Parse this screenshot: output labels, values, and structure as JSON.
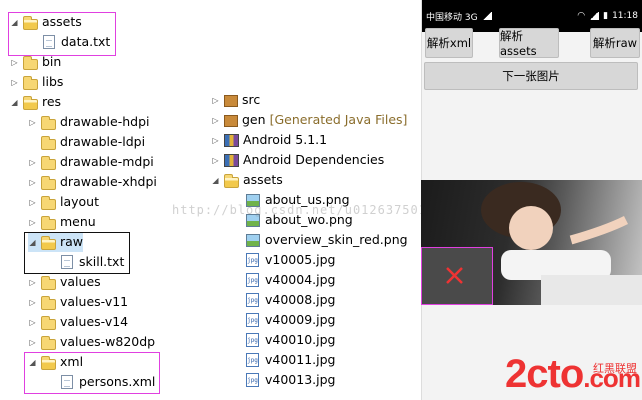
{
  "left_tree": [
    {
      "label": "assets",
      "level": 0,
      "type": "folder",
      "open": true,
      "twisty": "open"
    },
    {
      "label": "data.txt",
      "level": 1,
      "type": "file"
    },
    {
      "label": "bin",
      "level": 0,
      "type": "folder",
      "twisty": "closed"
    },
    {
      "label": "libs",
      "level": 0,
      "type": "folder",
      "twisty": "closed"
    },
    {
      "label": "res",
      "level": 0,
      "type": "folder",
      "open": true,
      "twisty": "open"
    },
    {
      "label": "drawable-hdpi",
      "level": 1,
      "type": "folder",
      "twisty": "closed"
    },
    {
      "label": "drawable-ldpi",
      "level": 1,
      "type": "folder"
    },
    {
      "label": "drawable-mdpi",
      "level": 1,
      "type": "folder",
      "twisty": "closed"
    },
    {
      "label": "drawable-xhdpi",
      "level": 1,
      "type": "folder",
      "twisty": "closed"
    },
    {
      "label": "layout",
      "level": 1,
      "type": "folder",
      "twisty": "closed"
    },
    {
      "label": "menu",
      "level": 1,
      "type": "folder",
      "twisty": "closed"
    },
    {
      "label": "raw",
      "level": 1,
      "type": "folder",
      "open": true,
      "twisty": "open",
      "selected": true
    },
    {
      "label": "skill.txt",
      "level": 2,
      "type": "file"
    },
    {
      "label": "values",
      "level": 1,
      "type": "folder",
      "twisty": "closed"
    },
    {
      "label": "values-v11",
      "level": 1,
      "type": "folder",
      "twisty": "closed"
    },
    {
      "label": "values-v14",
      "level": 1,
      "type": "folder",
      "twisty": "closed"
    },
    {
      "label": "values-w820dp",
      "level": 1,
      "type": "folder",
      "twisty": "closed"
    },
    {
      "label": "xml",
      "level": 1,
      "type": "folder",
      "open": true,
      "twisty": "open"
    },
    {
      "label": "persons.xml",
      "level": 2,
      "type": "file"
    }
  ],
  "mid_tree": [
    {
      "label": "src",
      "type": "pkg",
      "twisty": "closed"
    },
    {
      "label": "gen",
      "suffix": "[Generated Java Files]",
      "type": "pkg",
      "twisty": "closed"
    },
    {
      "label": "Android 5.1.1",
      "type": "lib",
      "twisty": "closed"
    },
    {
      "label": "Android Dependencies",
      "type": "lib",
      "twisty": "closed"
    },
    {
      "label": "assets",
      "type": "folder",
      "open": true,
      "twisty": "open"
    },
    {
      "label": "about_us.png",
      "type": "img"
    },
    {
      "label": "about_wo.png",
      "type": "img"
    },
    {
      "label": "overview_skin_red.png",
      "type": "img"
    },
    {
      "label": "v10005.jpg",
      "type": "jpg"
    },
    {
      "label": "v40004.jpg",
      "type": "jpg"
    },
    {
      "label": "v40008.jpg",
      "type": "jpg"
    },
    {
      "label": "v40009.jpg",
      "type": "jpg"
    },
    {
      "label": "v40010.jpg",
      "type": "jpg"
    },
    {
      "label": "v40011.jpg",
      "type": "jpg"
    },
    {
      "label": "v40013.jpg",
      "type": "jpg"
    }
  ],
  "phone": {
    "status_left": "中国移动 3G",
    "status_right": "11:18",
    "btn_xml": "解析xml",
    "btn_assets": "解析assets",
    "btn_raw": "解析raw",
    "btn_next": "下一张图片"
  },
  "watermark": "http://blog.csdn.net/u012637501",
  "logo": {
    "main": "2cto",
    "dotcom": ".com",
    "sub": "红黑联盟"
  },
  "colors": {
    "highlight": "#e040e0",
    "selection": "#cce4f7"
  }
}
